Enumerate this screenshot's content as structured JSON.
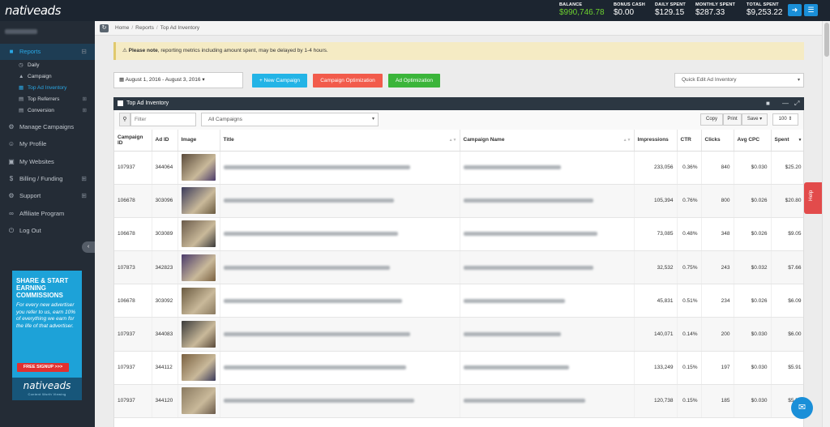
{
  "brand": {
    "logo_text": "nativeads"
  },
  "header": {
    "stats": [
      {
        "label": "BALANCE",
        "value": "$990,746.78"
      },
      {
        "label": "BONUS CASH",
        "value": "$0.00"
      },
      {
        "label": "DAILY SPENT",
        "value": "$129.15"
      },
      {
        "label": "MONTHLY SPENT",
        "value": "$287.33"
      },
      {
        "label": "TOTAL SPENT",
        "value": "$9,253.22"
      }
    ],
    "signout_icon": "exit-icon",
    "menu_icon": "hamburger-icon"
  },
  "sidebar": {
    "items": [
      {
        "label": "Reports",
        "icon": "chart-icon",
        "expand": "⊟"
      },
      {
        "label": "Manage Campaigns",
        "icon": "gears-icon"
      },
      {
        "label": "My Profile",
        "icon": "user-icon"
      },
      {
        "label": "My Websites",
        "icon": "monitor-icon"
      },
      {
        "label": "Billing / Funding",
        "icon": "dollar-icon",
        "expand": "⊞"
      },
      {
        "label": "Support",
        "icon": "support-icon",
        "expand": "⊞"
      },
      {
        "label": "Affiliate Program",
        "icon": "affiliate-icon"
      },
      {
        "label": "Log Out",
        "icon": "power-icon"
      }
    ],
    "sub_items": [
      {
        "label": "Daily"
      },
      {
        "label": "Campaign"
      },
      {
        "label": "Top Ad Inventory"
      },
      {
        "label": "Top Referrers",
        "expand": "⊞"
      },
      {
        "label": "Conversion",
        "expand": "⊞"
      }
    ],
    "collapse_glyph": "‹"
  },
  "promo": {
    "headline": "SHARE & START EARNING COMMISSIONS",
    "body": "For every new advertiser you refer to us, earn 10% of everything we earn for the life of that advertiser.",
    "cta": "FREE SIGNUP >>>",
    "logo": "nativeads",
    "tagline": "Content Worth Viewing"
  },
  "breadcrumb": [
    "Home",
    "Reports",
    "Top Ad Inventory"
  ],
  "notice": {
    "bold": "Please note",
    "text": ", reporting metrics including amount spent, may be delayed by 1-4 hours."
  },
  "date_range": "August 1, 2016 - August 3, 2016",
  "buttons": {
    "new_campaign": "+ New Campaign",
    "campaign_optimization": "Campaign Optimization",
    "ad_optimization": "Ad Optimization",
    "quick_edit": "Quick Edit Ad Inventory"
  },
  "colors": {
    "new_campaign": "#23b4e6",
    "campaign_optimization": "#f25b4b",
    "ad_optimization": "#3bb53a",
    "balance": "#6ccf2f",
    "accent": "#1a8fd8"
  },
  "panel": {
    "title": "Top Ad Inventory"
  },
  "toolbar": {
    "filter_placeholder": "Filter",
    "campaign_select": "All Campaigns",
    "copy": "Copy",
    "print": "Print",
    "save": "Save",
    "page_size": "100"
  },
  "table": {
    "columns": [
      "Campaign ID",
      "Ad ID",
      "Image",
      "Title",
      "Campaign Name",
      "Impressions",
      "CTR",
      "Clicks",
      "Avg CPC",
      "Spent"
    ],
    "rows": [
      {
        "campaign_id": "107937",
        "ad_id": "344064",
        "impressions": "233,056",
        "ctr": "0.36%",
        "clicks": "840",
        "avg_cpc": "$0.030",
        "spent": "$25.20"
      },
      {
        "campaign_id": "106678",
        "ad_id": "303096",
        "impressions": "105,394",
        "ctr": "0.76%",
        "clicks": "800",
        "avg_cpc": "$0.026",
        "spent": "$20.80"
      },
      {
        "campaign_id": "106678",
        "ad_id": "303089",
        "impressions": "73,085",
        "ctr": "0.48%",
        "clicks": "348",
        "avg_cpc": "$0.026",
        "spent": "$9.05"
      },
      {
        "campaign_id": "107873",
        "ad_id": "342823",
        "impressions": "32,532",
        "ctr": "0.75%",
        "clicks": "243",
        "avg_cpc": "$0.032",
        "spent": "$7.66"
      },
      {
        "campaign_id": "106678",
        "ad_id": "303092",
        "impressions": "45,831",
        "ctr": "0.51%",
        "clicks": "234",
        "avg_cpc": "$0.026",
        "spent": "$6.09"
      },
      {
        "campaign_id": "107937",
        "ad_id": "344083",
        "impressions": "140,071",
        "ctr": "0.14%",
        "clicks": "200",
        "avg_cpc": "$0.030",
        "spent": "$6.00"
      },
      {
        "campaign_id": "107937",
        "ad_id": "344112",
        "impressions": "133,249",
        "ctr": "0.15%",
        "clicks": "197",
        "avg_cpc": "$0.030",
        "spent": "$5.91"
      },
      {
        "campaign_id": "107937",
        "ad_id": "344120",
        "impressions": "120,738",
        "ctr": "0.15%",
        "clicks": "185",
        "avg_cpc": "$0.030",
        "spent": "$5.55"
      }
    ]
  },
  "help_tab": "Help"
}
